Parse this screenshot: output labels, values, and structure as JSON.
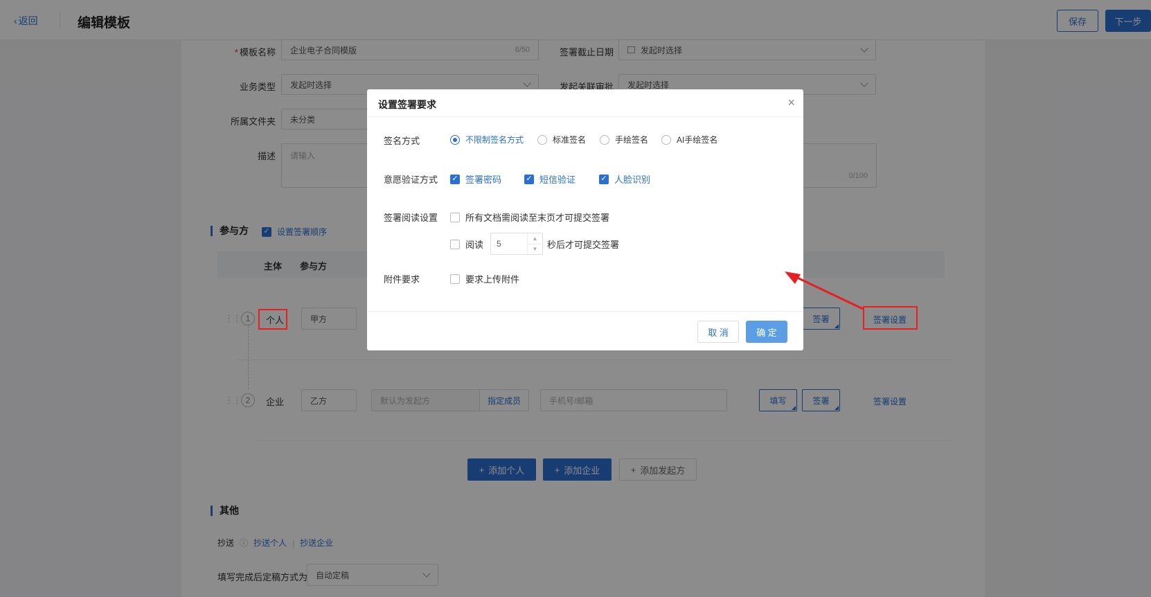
{
  "header": {
    "back_label": "返回",
    "title": "编辑模板",
    "save_label": "保存",
    "next_label": "下一步"
  },
  "form": {
    "template_name_label": "模板名称",
    "template_name_value": "企业电子合同模版",
    "template_name_count": "8/50",
    "deadline_label": "签署截止日期",
    "deadline_value": "发起时选择",
    "biz_type_label": "业务类型",
    "biz_type_value": "发起时选择",
    "approval_label": "发起关联审批",
    "approval_value": "发起时选择",
    "folder_label": "所属文件夹",
    "folder_value": "未分类",
    "desc_label": "描述",
    "desc_placeholder": "请输入",
    "desc_count": "0/100"
  },
  "participants": {
    "section_title": "参与方",
    "set_order_label": "设置签署顺序",
    "col_subject": "主体",
    "col_party": "参与方",
    "rows": [
      {
        "num": "1",
        "subject": "个人",
        "party": "甲方",
        "sign_btn": "签署",
        "settings_link": "签署设置"
      },
      {
        "num": "2",
        "subject": "企业",
        "party": "乙方",
        "signer_placeholder": "默认为发起方",
        "assign_label": "指定成员",
        "contact_placeholder": "手机号/邮箱",
        "fill_btn": "填写",
        "sign_btn": "签署",
        "settings_link": "签署设置"
      }
    ],
    "add_person": "添加个人",
    "add_company": "添加企业",
    "add_initiator": "添加发起方"
  },
  "others": {
    "section_title": "其他",
    "cc_label": "抄送",
    "cc_person": "抄送个人",
    "cc_sep": "|",
    "cc_company": "抄送企业",
    "finalize_label": "填写完成后定稿方式为",
    "finalize_value": "自动定稿"
  },
  "modal": {
    "title": "设置签署要求",
    "sign_method_label": "签名方式",
    "sign_methods": [
      "不限制签名方式",
      "标准签名",
      "手绘签名",
      "AI手绘签名"
    ],
    "sign_method_selected": "不限制签名方式",
    "verify_label": "意愿验证方式",
    "verify_options": [
      "签署密码",
      "短信验证",
      "人脸识别"
    ],
    "read_label": "签署阅读设置",
    "read_all_label": "所有文档需阅读至末页才可提交签署",
    "read_prefix": "阅读",
    "read_seconds": "5",
    "read_suffix": "秒后才可提交签署",
    "attach_label": "附件要求",
    "attach_option": "要求上传附件",
    "cancel_label": "取 消",
    "ok_label": "确 定"
  },
  "colors": {
    "primary": "#2a6fd1",
    "highlight": "#e62020"
  }
}
